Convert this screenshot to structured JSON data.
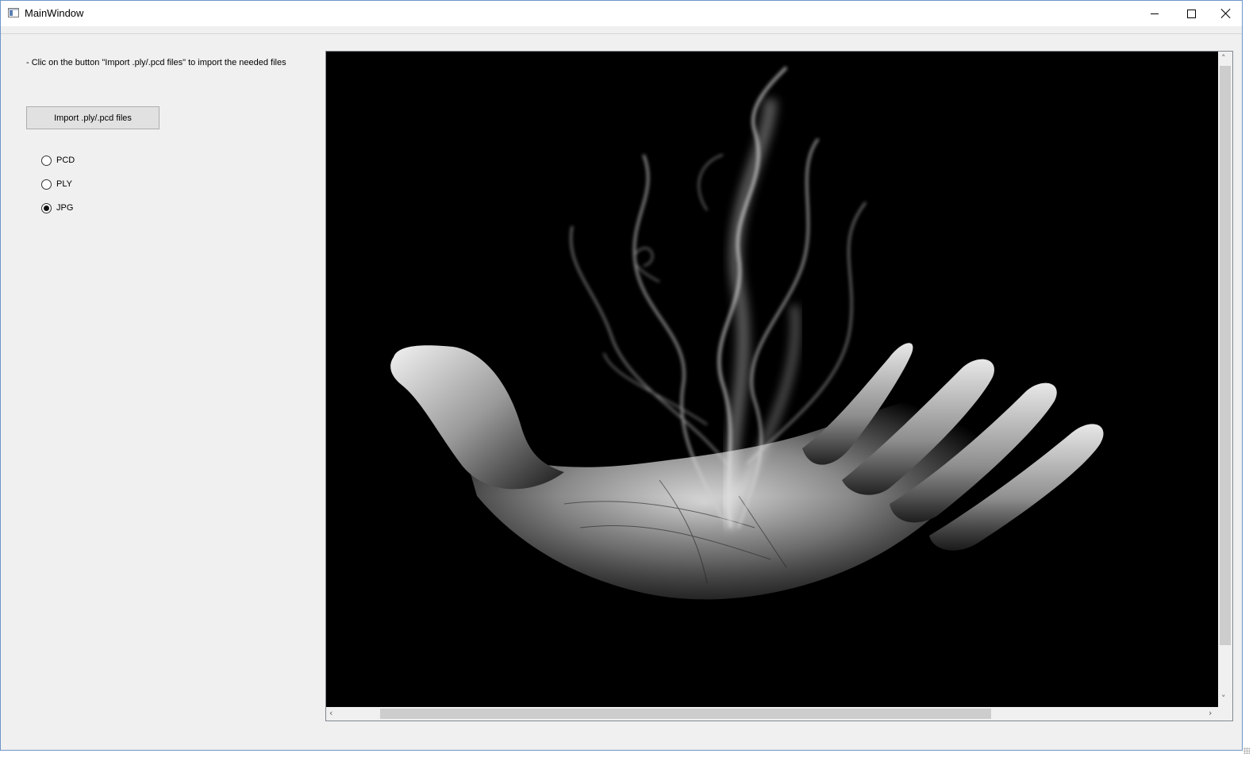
{
  "window": {
    "title": "MainWindow",
    "controls": {
      "minimize": "minimize-icon",
      "maximize": "maximize-icon",
      "close": "close-icon"
    }
  },
  "panel": {
    "instruction": "- Clic on the button \"Import .ply/.pcd files\" to import the needed files",
    "import_button_label": "Import .ply/.pcd files",
    "format_options": [
      {
        "label": "PCD",
        "checked": false
      },
      {
        "label": "PLY",
        "checked": false
      },
      {
        "label": "JPG",
        "checked": true
      }
    ]
  },
  "viewer": {
    "image_description": "hand-with-smoke-photo",
    "scrollbars": {
      "vertical": true,
      "horizontal": true
    }
  }
}
